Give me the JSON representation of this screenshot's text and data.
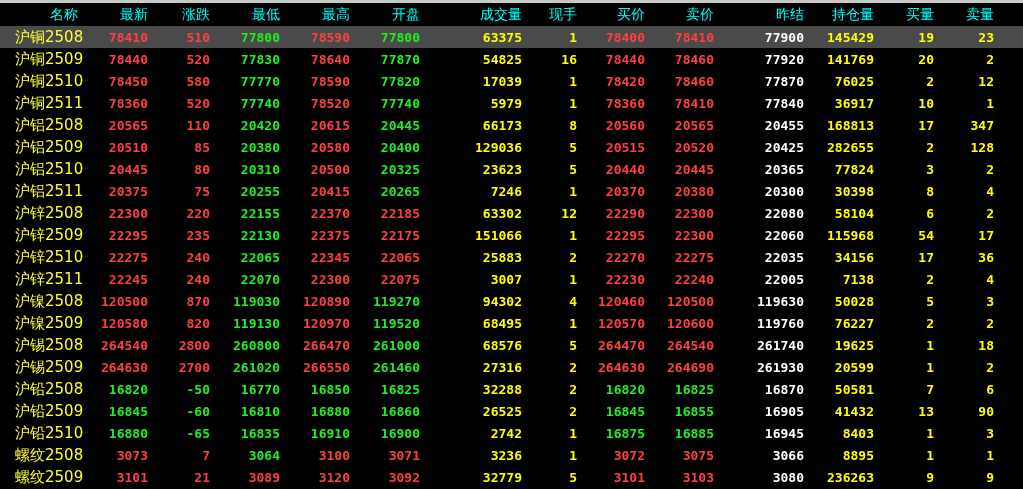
{
  "columns": [
    {
      "label": "名称",
      "kind": "name"
    },
    {
      "label": "最新",
      "kind": "price"
    },
    {
      "label": "涨跌",
      "kind": "price"
    },
    {
      "label": "最低",
      "kind": "price"
    },
    {
      "label": "最高",
      "kind": "price"
    },
    {
      "label": "开盘",
      "kind": "price"
    },
    {
      "label": "成交量",
      "kind": "volume"
    },
    {
      "label": "现手",
      "kind": "volume"
    },
    {
      "label": "买价",
      "kind": "price"
    },
    {
      "label": "卖价",
      "kind": "price"
    },
    {
      "label": "昨结",
      "kind": "settle"
    },
    {
      "label": "持仓量",
      "kind": "volume"
    },
    {
      "label": "买量",
      "kind": "volume"
    },
    {
      "label": "卖量",
      "kind": "volume"
    }
  ],
  "rows": [
    {
      "selected": true,
      "cells": [
        {
          "text": "沪铜2508"
        },
        {
          "text": "78410",
          "color": "#ff4040"
        },
        {
          "text": "510",
          "color": "#ff4040"
        },
        {
          "text": "77800",
          "color": "#22ee22"
        },
        {
          "text": "78590",
          "color": "#ff4040"
        },
        {
          "text": "77800",
          "color": "#22ee22"
        },
        {
          "text": "63375"
        },
        {
          "text": "1"
        },
        {
          "text": "78400",
          "color": "#ff4040"
        },
        {
          "text": "78410",
          "color": "#ff4040"
        },
        {
          "text": "77900"
        },
        {
          "text": "145429"
        },
        {
          "text": "19"
        },
        {
          "text": "23"
        }
      ]
    },
    {
      "selected": false,
      "cells": [
        {
          "text": "沪铜2509"
        },
        {
          "text": "78440",
          "color": "#ff4040"
        },
        {
          "text": "520",
          "color": "#ff4040"
        },
        {
          "text": "77830",
          "color": "#22ee22"
        },
        {
          "text": "78640",
          "color": "#ff4040"
        },
        {
          "text": "77870",
          "color": "#22ee22"
        },
        {
          "text": "54825"
        },
        {
          "text": "16"
        },
        {
          "text": "78440",
          "color": "#ff4040"
        },
        {
          "text": "78460",
          "color": "#ff4040"
        },
        {
          "text": "77920"
        },
        {
          "text": "141769"
        },
        {
          "text": "20"
        },
        {
          "text": "2"
        }
      ]
    },
    {
      "selected": false,
      "cells": [
        {
          "text": "沪铜2510"
        },
        {
          "text": "78450",
          "color": "#ff4040"
        },
        {
          "text": "580",
          "color": "#ff4040"
        },
        {
          "text": "77770",
          "color": "#22ee22"
        },
        {
          "text": "78590",
          "color": "#ff4040"
        },
        {
          "text": "77820",
          "color": "#22ee22"
        },
        {
          "text": "17039"
        },
        {
          "text": "1"
        },
        {
          "text": "78420",
          "color": "#ff4040"
        },
        {
          "text": "78460",
          "color": "#ff4040"
        },
        {
          "text": "77870"
        },
        {
          "text": "76025"
        },
        {
          "text": "2"
        },
        {
          "text": "12"
        }
      ]
    },
    {
      "selected": false,
      "cells": [
        {
          "text": "沪铜2511"
        },
        {
          "text": "78360",
          "color": "#ff4040"
        },
        {
          "text": "520",
          "color": "#ff4040"
        },
        {
          "text": "77740",
          "color": "#22ee22"
        },
        {
          "text": "78520",
          "color": "#ff4040"
        },
        {
          "text": "77740",
          "color": "#22ee22"
        },
        {
          "text": "5979"
        },
        {
          "text": "1"
        },
        {
          "text": "78360",
          "color": "#ff4040"
        },
        {
          "text": "78410",
          "color": "#ff4040"
        },
        {
          "text": "77840"
        },
        {
          "text": "36917"
        },
        {
          "text": "10"
        },
        {
          "text": "1"
        }
      ]
    },
    {
      "selected": false,
      "cells": [
        {
          "text": "沪铝2508"
        },
        {
          "text": "20565",
          "color": "#ff4040"
        },
        {
          "text": "110",
          "color": "#ff4040"
        },
        {
          "text": "20420",
          "color": "#22ee22"
        },
        {
          "text": "20615",
          "color": "#ff4040"
        },
        {
          "text": "20445",
          "color": "#22ee22"
        },
        {
          "text": "66173"
        },
        {
          "text": "8"
        },
        {
          "text": "20560",
          "color": "#ff4040"
        },
        {
          "text": "20565",
          "color": "#ff4040"
        },
        {
          "text": "20455"
        },
        {
          "text": "168813"
        },
        {
          "text": "17"
        },
        {
          "text": "347"
        }
      ]
    },
    {
      "selected": false,
      "cells": [
        {
          "text": "沪铝2509"
        },
        {
          "text": "20510",
          "color": "#ff4040"
        },
        {
          "text": "85",
          "color": "#ff4040"
        },
        {
          "text": "20380",
          "color": "#22ee22"
        },
        {
          "text": "20580",
          "color": "#ff4040"
        },
        {
          "text": "20400",
          "color": "#22ee22"
        },
        {
          "text": "129036"
        },
        {
          "text": "5"
        },
        {
          "text": "20515",
          "color": "#ff4040"
        },
        {
          "text": "20520",
          "color": "#ff4040"
        },
        {
          "text": "20425"
        },
        {
          "text": "282655"
        },
        {
          "text": "2"
        },
        {
          "text": "128"
        }
      ]
    },
    {
      "selected": false,
      "cells": [
        {
          "text": "沪铝2510"
        },
        {
          "text": "20445",
          "color": "#ff4040"
        },
        {
          "text": "80",
          "color": "#ff4040"
        },
        {
          "text": "20310",
          "color": "#22ee22"
        },
        {
          "text": "20500",
          "color": "#ff4040"
        },
        {
          "text": "20325",
          "color": "#22ee22"
        },
        {
          "text": "23623"
        },
        {
          "text": "5"
        },
        {
          "text": "20440",
          "color": "#ff4040"
        },
        {
          "text": "20445",
          "color": "#ff4040"
        },
        {
          "text": "20365"
        },
        {
          "text": "77824"
        },
        {
          "text": "3"
        },
        {
          "text": "2"
        }
      ]
    },
    {
      "selected": false,
      "cells": [
        {
          "text": "沪铝2511"
        },
        {
          "text": "20375",
          "color": "#ff4040"
        },
        {
          "text": "75",
          "color": "#ff4040"
        },
        {
          "text": "20255",
          "color": "#22ee22"
        },
        {
          "text": "20415",
          "color": "#ff4040"
        },
        {
          "text": "20265",
          "color": "#22ee22"
        },
        {
          "text": "7246"
        },
        {
          "text": "1"
        },
        {
          "text": "20370",
          "color": "#ff4040"
        },
        {
          "text": "20380",
          "color": "#ff4040"
        },
        {
          "text": "20300"
        },
        {
          "text": "30398"
        },
        {
          "text": "8"
        },
        {
          "text": "4"
        }
      ]
    },
    {
      "selected": false,
      "cells": [
        {
          "text": "沪锌2508"
        },
        {
          "text": "22300",
          "color": "#ff4040"
        },
        {
          "text": "220",
          "color": "#ff4040"
        },
        {
          "text": "22155",
          "color": "#22ee22"
        },
        {
          "text": "22370",
          "color": "#ff4040"
        },
        {
          "text": "22185",
          "color": "#ff4040"
        },
        {
          "text": "63302"
        },
        {
          "text": "12"
        },
        {
          "text": "22290",
          "color": "#ff4040"
        },
        {
          "text": "22300",
          "color": "#ff4040"
        },
        {
          "text": "22080"
        },
        {
          "text": "58104"
        },
        {
          "text": "6"
        },
        {
          "text": "2"
        }
      ]
    },
    {
      "selected": false,
      "cells": [
        {
          "text": "沪锌2509"
        },
        {
          "text": "22295",
          "color": "#ff4040"
        },
        {
          "text": "235",
          "color": "#ff4040"
        },
        {
          "text": "22130",
          "color": "#22ee22"
        },
        {
          "text": "22375",
          "color": "#ff4040"
        },
        {
          "text": "22175",
          "color": "#ff4040"
        },
        {
          "text": "151066"
        },
        {
          "text": "1"
        },
        {
          "text": "22295",
          "color": "#ff4040"
        },
        {
          "text": "22300",
          "color": "#ff4040"
        },
        {
          "text": "22060"
        },
        {
          "text": "115968"
        },
        {
          "text": "54"
        },
        {
          "text": "17"
        }
      ]
    },
    {
      "selected": false,
      "cells": [
        {
          "text": "沪锌2510"
        },
        {
          "text": "22275",
          "color": "#ff4040"
        },
        {
          "text": "240",
          "color": "#ff4040"
        },
        {
          "text": "22065",
          "color": "#22ee22"
        },
        {
          "text": "22345",
          "color": "#ff4040"
        },
        {
          "text": "22065",
          "color": "#ff4040"
        },
        {
          "text": "25883"
        },
        {
          "text": "2"
        },
        {
          "text": "22270",
          "color": "#ff4040"
        },
        {
          "text": "22275",
          "color": "#ff4040"
        },
        {
          "text": "22035"
        },
        {
          "text": "34156"
        },
        {
          "text": "17"
        },
        {
          "text": "36"
        }
      ]
    },
    {
      "selected": false,
      "cells": [
        {
          "text": "沪锌2511"
        },
        {
          "text": "22245",
          "color": "#ff4040"
        },
        {
          "text": "240",
          "color": "#ff4040"
        },
        {
          "text": "22070",
          "color": "#22ee22"
        },
        {
          "text": "22300",
          "color": "#ff4040"
        },
        {
          "text": "22075",
          "color": "#ff4040"
        },
        {
          "text": "3007"
        },
        {
          "text": "1"
        },
        {
          "text": "22230",
          "color": "#ff4040"
        },
        {
          "text": "22240",
          "color": "#ff4040"
        },
        {
          "text": "22005"
        },
        {
          "text": "7138"
        },
        {
          "text": "2"
        },
        {
          "text": "4"
        }
      ]
    },
    {
      "selected": false,
      "cells": [
        {
          "text": "沪镍2508"
        },
        {
          "text": "120500",
          "color": "#ff4040"
        },
        {
          "text": "870",
          "color": "#ff4040"
        },
        {
          "text": "119030",
          "color": "#22ee22"
        },
        {
          "text": "120890",
          "color": "#ff4040"
        },
        {
          "text": "119270",
          "color": "#22ee22"
        },
        {
          "text": "94302"
        },
        {
          "text": "4"
        },
        {
          "text": "120460",
          "color": "#ff4040"
        },
        {
          "text": "120500",
          "color": "#ff4040"
        },
        {
          "text": "119630"
        },
        {
          "text": "50028"
        },
        {
          "text": "5"
        },
        {
          "text": "3"
        }
      ]
    },
    {
      "selected": false,
      "cells": [
        {
          "text": "沪镍2509"
        },
        {
          "text": "120580",
          "color": "#ff4040"
        },
        {
          "text": "820",
          "color": "#ff4040"
        },
        {
          "text": "119130",
          "color": "#22ee22"
        },
        {
          "text": "120970",
          "color": "#ff4040"
        },
        {
          "text": "119520",
          "color": "#22ee22"
        },
        {
          "text": "68495"
        },
        {
          "text": "1"
        },
        {
          "text": "120570",
          "color": "#ff4040"
        },
        {
          "text": "120600",
          "color": "#ff4040"
        },
        {
          "text": "119760"
        },
        {
          "text": "76227"
        },
        {
          "text": "2"
        },
        {
          "text": "2"
        }
      ]
    },
    {
      "selected": false,
      "cells": [
        {
          "text": "沪锡2508"
        },
        {
          "text": "264540",
          "color": "#ff4040"
        },
        {
          "text": "2800",
          "color": "#ff4040"
        },
        {
          "text": "260800",
          "color": "#22ee22"
        },
        {
          "text": "266470",
          "color": "#ff4040"
        },
        {
          "text": "261000",
          "color": "#22ee22"
        },
        {
          "text": "68576"
        },
        {
          "text": "5"
        },
        {
          "text": "264470",
          "color": "#ff4040"
        },
        {
          "text": "264540",
          "color": "#ff4040"
        },
        {
          "text": "261740"
        },
        {
          "text": "19625"
        },
        {
          "text": "1"
        },
        {
          "text": "18"
        }
      ]
    },
    {
      "selected": false,
      "cells": [
        {
          "text": "沪锡2509"
        },
        {
          "text": "264630",
          "color": "#ff4040"
        },
        {
          "text": "2700",
          "color": "#ff4040"
        },
        {
          "text": "261020",
          "color": "#22ee22"
        },
        {
          "text": "266550",
          "color": "#ff4040"
        },
        {
          "text": "261460",
          "color": "#22ee22"
        },
        {
          "text": "27316"
        },
        {
          "text": "2"
        },
        {
          "text": "264630",
          "color": "#ff4040"
        },
        {
          "text": "264690",
          "color": "#ff4040"
        },
        {
          "text": "261930"
        },
        {
          "text": "20599"
        },
        {
          "text": "1"
        },
        {
          "text": "2"
        }
      ]
    },
    {
      "selected": false,
      "cells": [
        {
          "text": "沪铅2508"
        },
        {
          "text": "16820",
          "color": "#22ee22"
        },
        {
          "text": "-50",
          "color": "#22ee22"
        },
        {
          "text": "16770",
          "color": "#22ee22"
        },
        {
          "text": "16850",
          "color": "#22ee22"
        },
        {
          "text": "16825",
          "color": "#22ee22"
        },
        {
          "text": "32288"
        },
        {
          "text": "2"
        },
        {
          "text": "16820",
          "color": "#22ee22"
        },
        {
          "text": "16825",
          "color": "#22ee22"
        },
        {
          "text": "16870"
        },
        {
          "text": "50581"
        },
        {
          "text": "7"
        },
        {
          "text": "6"
        }
      ]
    },
    {
      "selected": false,
      "cells": [
        {
          "text": "沪铅2509"
        },
        {
          "text": "16845",
          "color": "#22ee22"
        },
        {
          "text": "-60",
          "color": "#22ee22"
        },
        {
          "text": "16810",
          "color": "#22ee22"
        },
        {
          "text": "16880",
          "color": "#22ee22"
        },
        {
          "text": "16860",
          "color": "#22ee22"
        },
        {
          "text": "26525"
        },
        {
          "text": "2"
        },
        {
          "text": "16845",
          "color": "#22ee22"
        },
        {
          "text": "16855",
          "color": "#22ee22"
        },
        {
          "text": "16905"
        },
        {
          "text": "41432"
        },
        {
          "text": "13"
        },
        {
          "text": "90"
        }
      ]
    },
    {
      "selected": false,
      "cells": [
        {
          "text": "沪铅2510"
        },
        {
          "text": "16880",
          "color": "#22ee22"
        },
        {
          "text": "-65",
          "color": "#22ee22"
        },
        {
          "text": "16835",
          "color": "#22ee22"
        },
        {
          "text": "16910",
          "color": "#22ee22"
        },
        {
          "text": "16900",
          "color": "#22ee22"
        },
        {
          "text": "2742"
        },
        {
          "text": "1"
        },
        {
          "text": "16875",
          "color": "#22ee22"
        },
        {
          "text": "16885",
          "color": "#22ee22"
        },
        {
          "text": "16945"
        },
        {
          "text": "8403"
        },
        {
          "text": "1"
        },
        {
          "text": "3"
        }
      ]
    },
    {
      "selected": false,
      "cells": [
        {
          "text": "螺纹2508"
        },
        {
          "text": "3073",
          "color": "#ff4040"
        },
        {
          "text": "7",
          "color": "#ff4040"
        },
        {
          "text": "3064",
          "color": "#22ee22"
        },
        {
          "text": "3100",
          "color": "#ff4040"
        },
        {
          "text": "3071",
          "color": "#ff4040"
        },
        {
          "text": "3236"
        },
        {
          "text": "1"
        },
        {
          "text": "3072",
          "color": "#ff4040"
        },
        {
          "text": "3075",
          "color": "#ff4040"
        },
        {
          "text": "3066"
        },
        {
          "text": "8895"
        },
        {
          "text": "1"
        },
        {
          "text": "1"
        }
      ]
    },
    {
      "selected": false,
      "cells": [
        {
          "text": "螺纹2509"
        },
        {
          "text": "3101",
          "color": "#ff4040"
        },
        {
          "text": "21",
          "color": "#ff4040"
        },
        {
          "text": "3089",
          "color": "#ff4040"
        },
        {
          "text": "3120",
          "color": "#ff4040"
        },
        {
          "text": "3092",
          "color": "#ff4040"
        },
        {
          "text": "32779"
        },
        {
          "text": "5"
        },
        {
          "text": "3101",
          "color": "#ff4040"
        },
        {
          "text": "3103",
          "color": "#ff4040"
        },
        {
          "text": "3080"
        },
        {
          "text": "236263"
        },
        {
          "text": "9"
        },
        {
          "text": "9"
        }
      ]
    }
  ]
}
